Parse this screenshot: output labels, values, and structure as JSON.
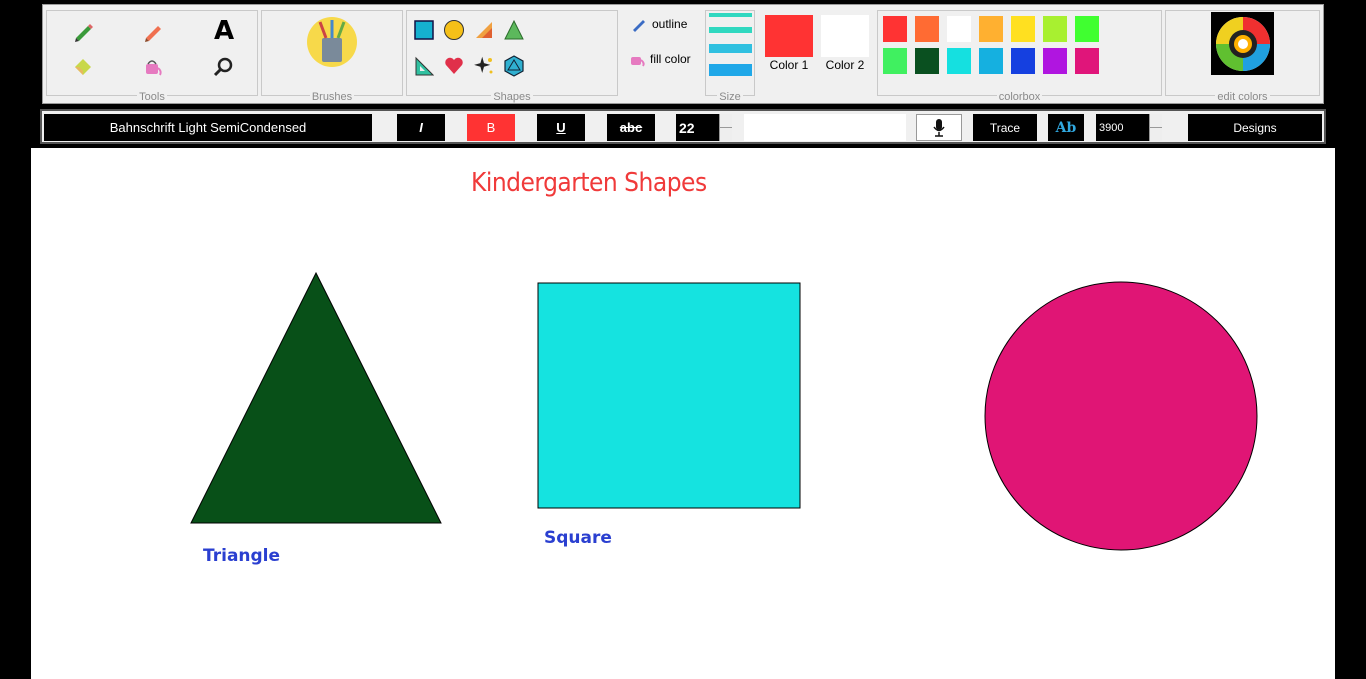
{
  "ribbon": {
    "groups": {
      "tools": "Tools",
      "brushes": "Brushes",
      "shapes": "Shapes",
      "size": "Size",
      "colorbox": "colorbox",
      "edit_colors": "edit colors"
    },
    "outline_label": "outline",
    "fill_label": "fill color",
    "color1_label": "Color 1",
    "color2_label": "Color 2",
    "color1_value": "#ff3333",
    "color2_value": "#ffffff",
    "tools_text_icon": "A",
    "palette": [
      "#ff3333",
      "#ff6b33",
      "#ffffff",
      "#ffb030",
      "#ffe020",
      "#a8f030",
      "#40ff30",
      "#40f060",
      "#0a5020",
      "#15e0e0",
      "#15b0e0",
      "#1540e0",
      "#b015e0",
      "#e0157a"
    ]
  },
  "formatbar": {
    "font_name": "Bahnschrift Light SemiCondensed",
    "italic": "I",
    "bold": "B",
    "underline": "U",
    "strike": "abc",
    "font_size": "22",
    "trace": "Trace",
    "ab": "Ab",
    "number": "3900",
    "designs": "Designs"
  },
  "canvas": {
    "title": "Kindergarten Shapes",
    "triangle_label": "Triangle",
    "square_label": "Square",
    "colors": {
      "triangle": "#085018",
      "square": "#15e3e0",
      "circle": "#e01575",
      "title": "#f03a3a",
      "captions": "#2a3fd0"
    }
  }
}
